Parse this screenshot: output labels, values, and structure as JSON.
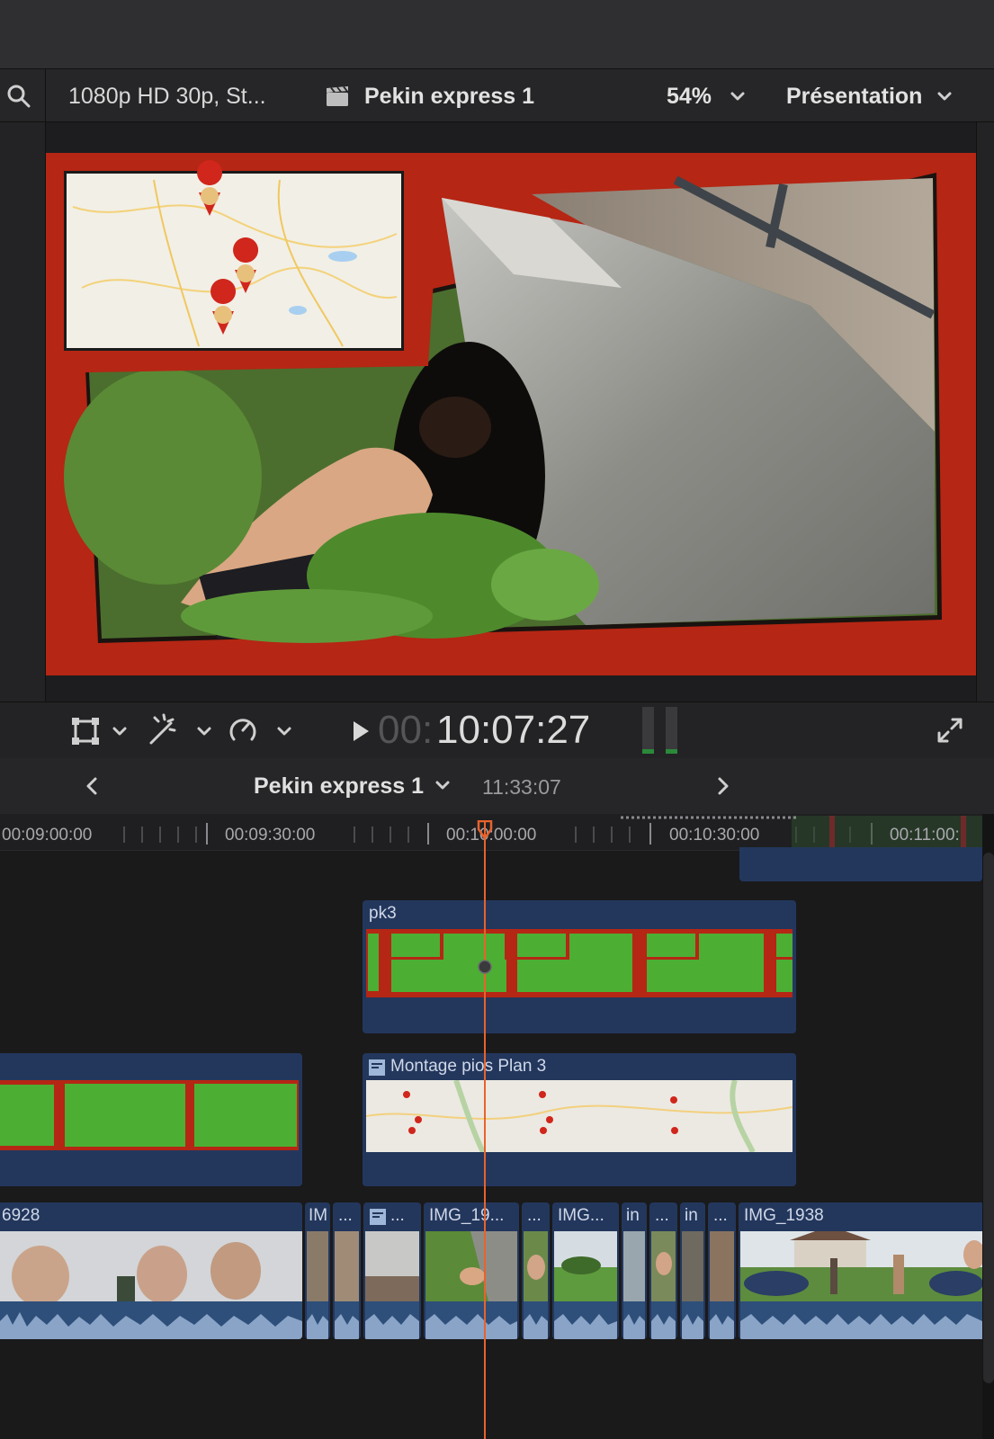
{
  "viewer_header": {
    "format": "1080p HD 30p, St...",
    "project": "Pekin express 1",
    "zoom": "54%",
    "view": "Présentation"
  },
  "viewer_controls": {
    "timecode_dim": "00:",
    "timecode": "10:07:27"
  },
  "timeline_header": {
    "project": "Pekin express 1",
    "duration": "11:33:07"
  },
  "ruler": {
    "ticks": [
      "00:09:00:00",
      "00:09:30:00",
      "00:10:00:00",
      "00:10:30:00",
      "00:11:00:"
    ]
  },
  "clips": {
    "pk3": "pk3",
    "montage": "Montage pios Plan 3",
    "storyline": [
      "6928",
      "IM",
      "...",
      "...",
      "IMG_19...",
      "...",
      "IMG...",
      "in",
      "...",
      "in",
      "...",
      "IMG_1938"
    ]
  },
  "colors": {
    "accent_red": "#b52614",
    "clip_blue": "#23375d",
    "playhead": "#e8622c",
    "green_placeholder": "#4cae33"
  }
}
